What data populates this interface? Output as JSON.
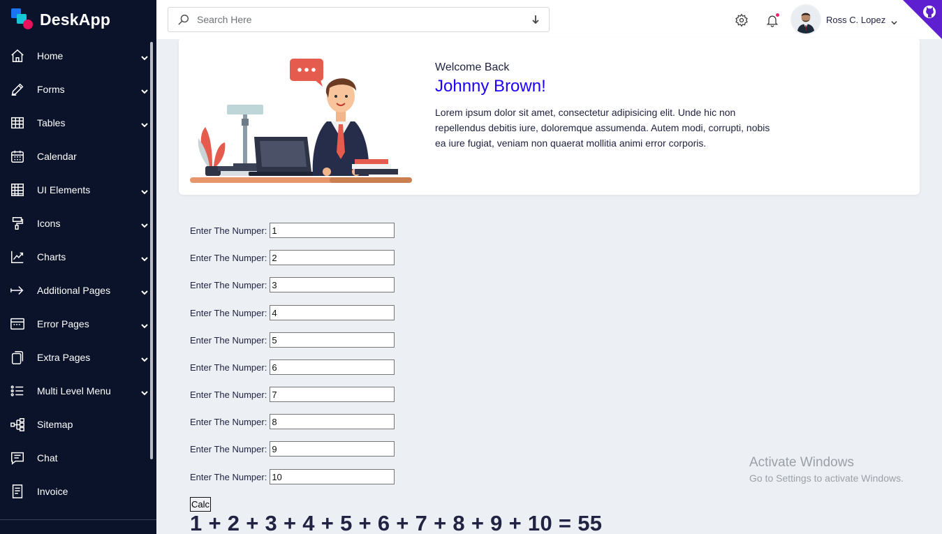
{
  "app": {
    "name": "DeskApp"
  },
  "sidebar": {
    "items": [
      {
        "label": "Home",
        "icon": "home-icon",
        "has_submenu": true
      },
      {
        "label": "Forms",
        "icon": "pencil-icon",
        "has_submenu": true
      },
      {
        "label": "Tables",
        "icon": "table-icon",
        "has_submenu": true
      },
      {
        "label": "Calendar",
        "icon": "calendar-icon",
        "has_submenu": false
      },
      {
        "label": "UI Elements",
        "icon": "grid-icon",
        "has_submenu": true
      },
      {
        "label": "Icons",
        "icon": "paint-roller-icon",
        "has_submenu": true
      },
      {
        "label": "Charts",
        "icon": "line-chart-icon",
        "has_submenu": true
      },
      {
        "label": "Additional Pages",
        "icon": "arrow-right-icon",
        "has_submenu": true
      },
      {
        "label": "Error Pages",
        "icon": "window-icon",
        "has_submenu": true
      },
      {
        "label": "Extra Pages",
        "icon": "copy-icon",
        "has_submenu": true
      },
      {
        "label": "Multi Level Menu",
        "icon": "list-icon",
        "has_submenu": true
      },
      {
        "label": "Sitemap",
        "icon": "sitemap-icon",
        "has_submenu": false
      },
      {
        "label": "Chat",
        "icon": "chat-icon",
        "has_submenu": false
      },
      {
        "label": "Invoice",
        "icon": "receipt-icon",
        "has_submenu": false
      }
    ]
  },
  "header": {
    "search_placeholder": "Search Here",
    "user_name": "Ross C. Lopez"
  },
  "welcome": {
    "subtitle": "Welcome Back",
    "name": "Johnny Brown!",
    "text": "Lorem ipsum dolor sit amet, consectetur adipisicing elit. Unde hic non repellendus debitis iure, doloremque assumenda. Autem modi, corrupti, nobis ea iure fugiat, veniam non quaerat mollitia animi error corporis."
  },
  "form": {
    "fields": [
      {
        "label": "Enter The Numper:",
        "value": "1"
      },
      {
        "label": "Enter The Numper:",
        "value": "2"
      },
      {
        "label": "Enter The Numper:",
        "value": "3"
      },
      {
        "label": "Enter The Numper:",
        "value": "4"
      },
      {
        "label": "Enter The Numper:",
        "value": "5"
      },
      {
        "label": "Enter The Numper:",
        "value": "6"
      },
      {
        "label": "Enter The Numper:",
        "value": "7"
      },
      {
        "label": "Enter The Numper:",
        "value": "8"
      },
      {
        "label": "Enter The Numper:",
        "value": "9"
      },
      {
        "label": "Enter The Numper:",
        "value": "10"
      }
    ],
    "button_label": "Calc",
    "result": "1 + 2 + 3 + 4 + 5 + 6 + 7 + 8 + 9 + 10 = 55"
  },
  "watermark": {
    "title": "Activate Windows",
    "subtitle": "Go to Settings to activate Windows."
  },
  "colors": {
    "sidebar_bg": "#0b132b",
    "accent": "#1b00ff",
    "page_bg": "#ecf0f4",
    "notification_dot": "#f0256f",
    "github_corner": "#5d1fd0"
  }
}
